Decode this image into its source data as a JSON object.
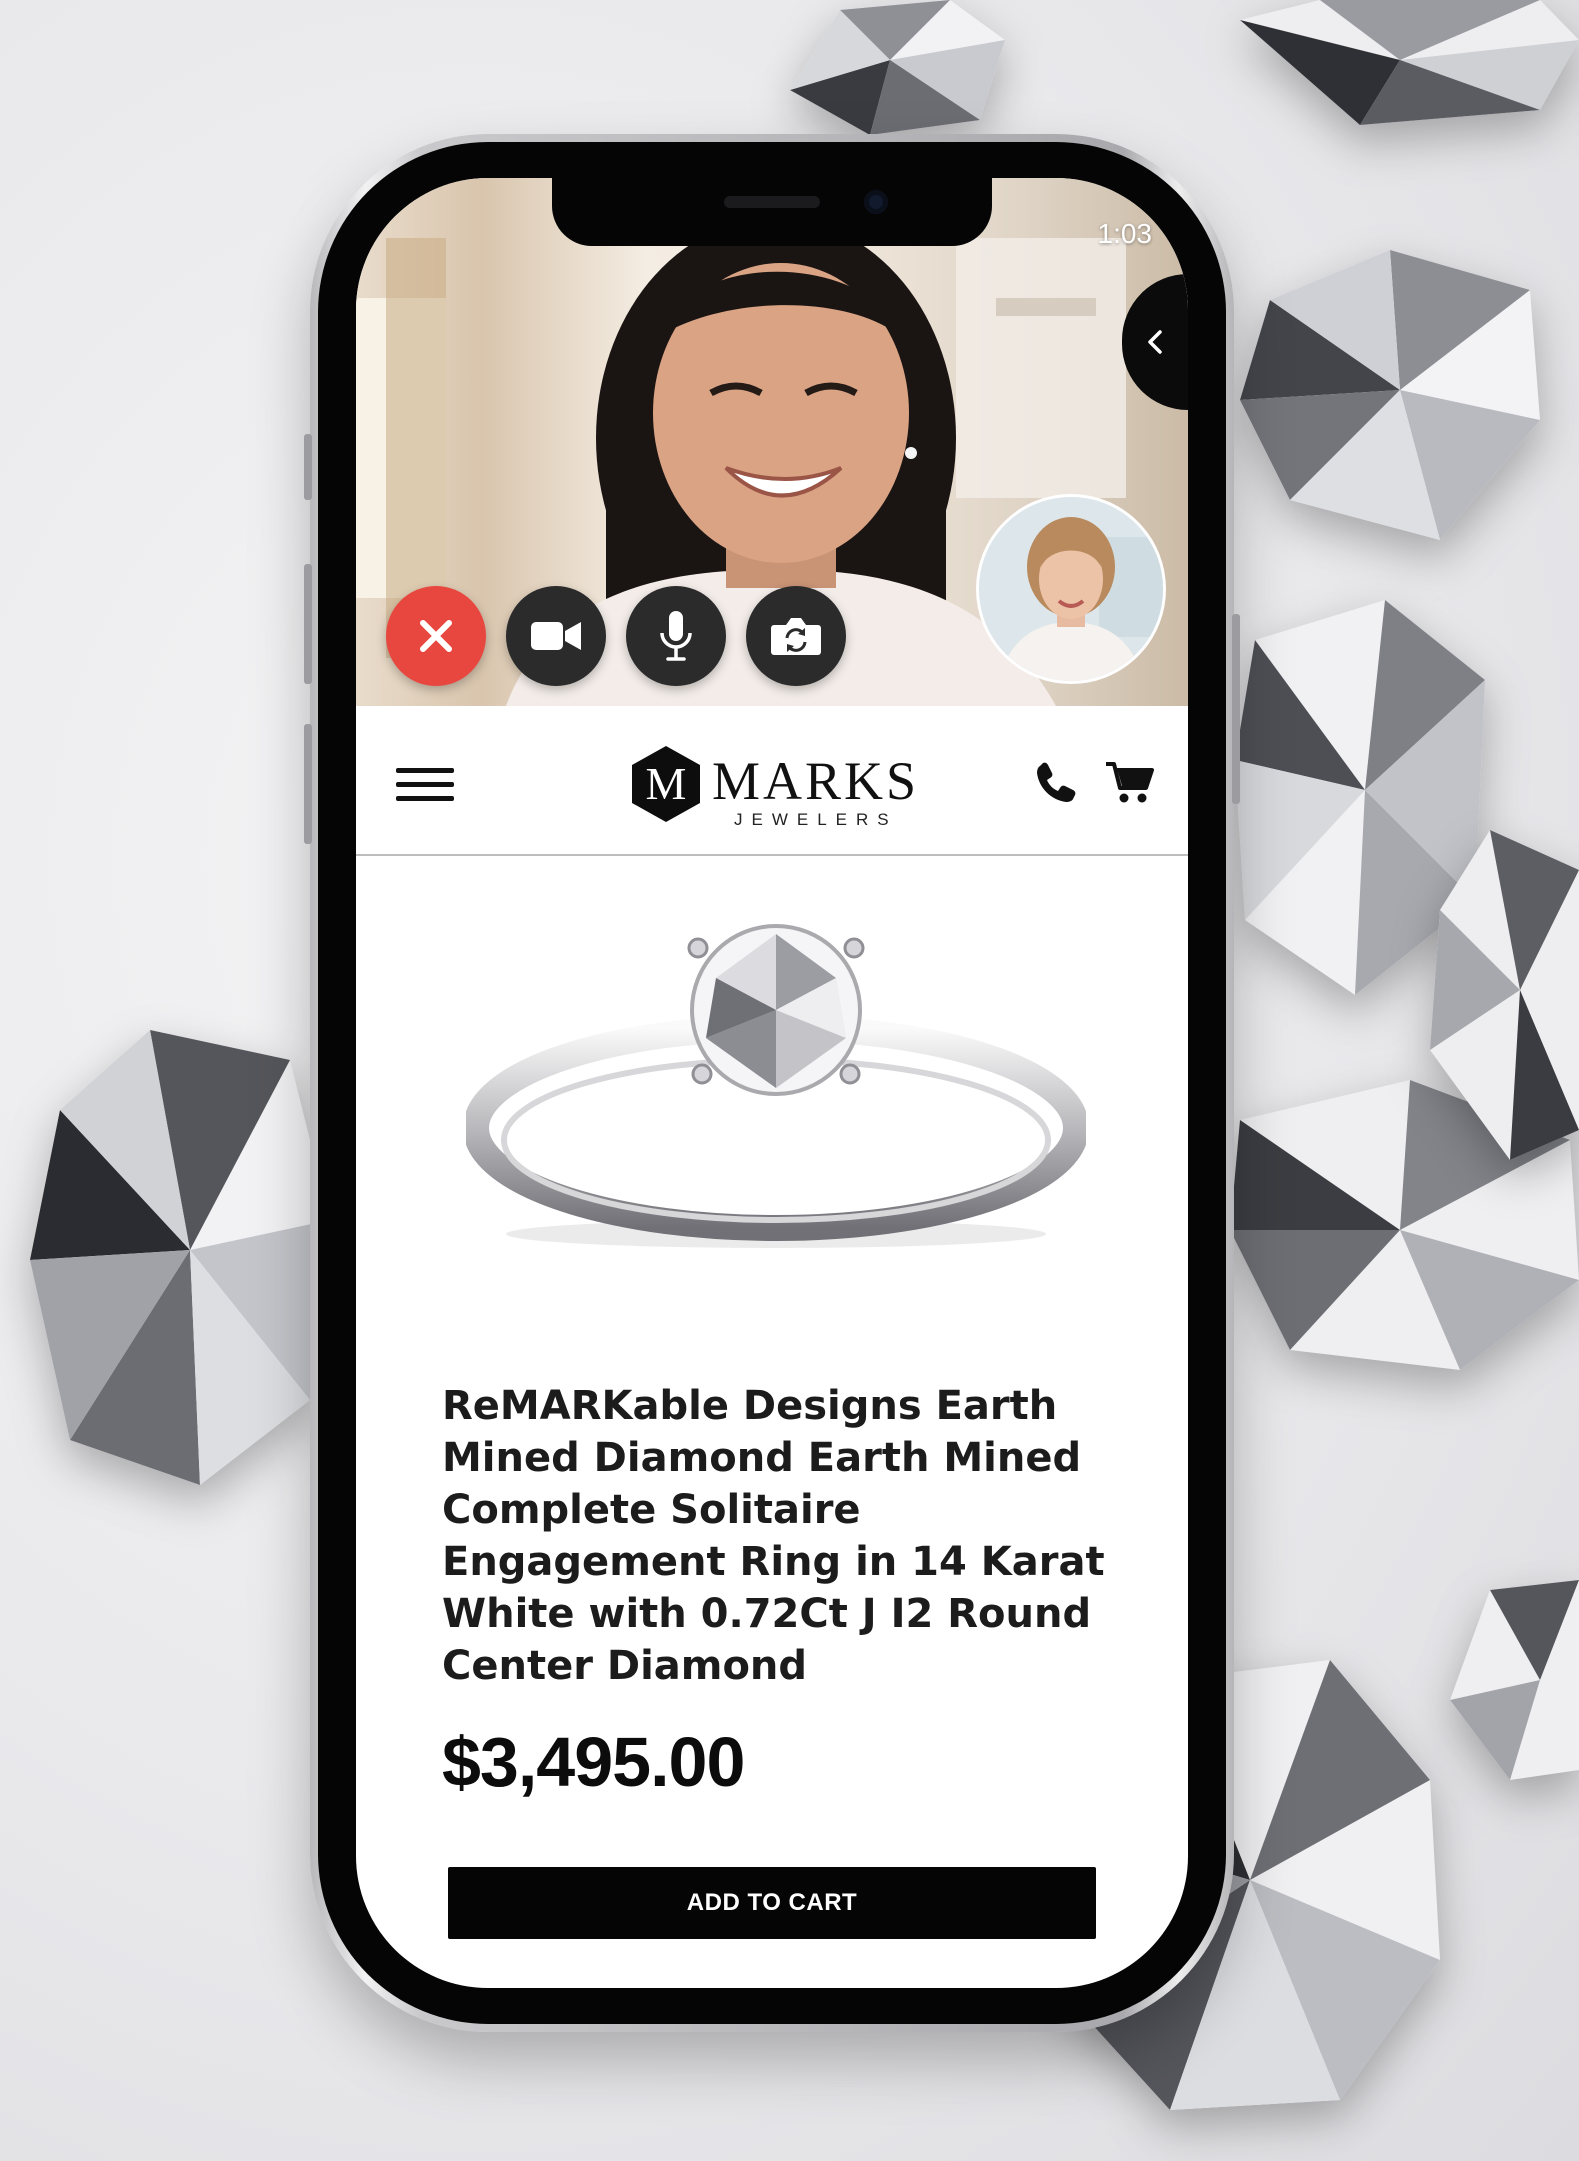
{
  "call": {
    "timer": "1:03",
    "controls": {
      "end": "close-icon",
      "video": "video-camera-icon",
      "mic": "microphone-icon",
      "switch_camera": "switch-camera-icon"
    },
    "end_color": "#e8473f",
    "control_color": "#2b2b2b"
  },
  "header": {
    "brand": "MARKS",
    "brand_sub": "JEWELERS",
    "monogram": "M"
  },
  "product": {
    "title": "ReMARKable Designs Earth Mined Diamond Earth Mined Complete Solitaire Engagement Ring in 14 Karat White with 0.72Ct J I2 Round Center Diamond",
    "price": "$3,495.00",
    "add_to_cart": "ADD TO CART"
  },
  "colors": {
    "button_bg": "#050505",
    "text": "#1c1c1c"
  }
}
